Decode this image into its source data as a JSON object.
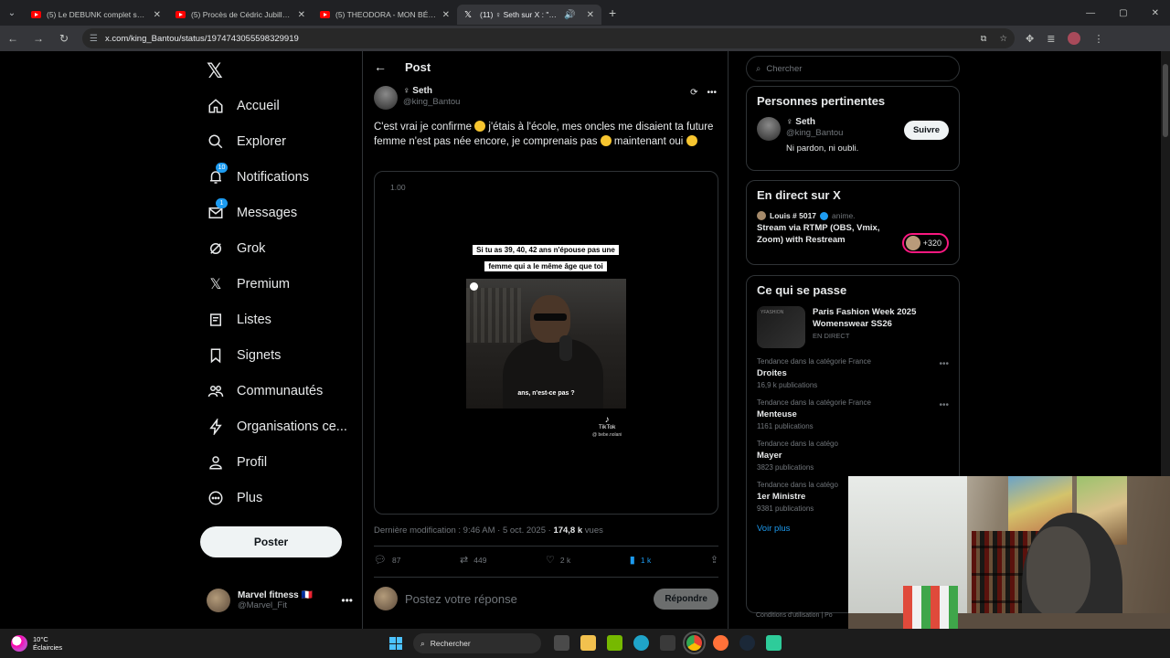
{
  "browser": {
    "tabs": [
      {
        "label": "(5) Le DEBUNK complet sur la P",
        "icon": "youtube-icon",
        "active": false
      },
      {
        "label": "(5) Procès de Cédric Jubillar - Y",
        "icon": "youtube-icon",
        "active": false
      },
      {
        "label": "(5) THEODORA - MON BÉBÉ (F",
        "icon": "youtube-icon",
        "active": false
      },
      {
        "label": "(11) ♀ Seth sur X : \"C'est vrai",
        "icon": "x-icon",
        "active": true
      }
    ],
    "url": "x.com/king_Bantou/status/1974743055598329919"
  },
  "nav": {
    "logo": "𝕏",
    "items": [
      {
        "label": "Accueil",
        "icon": "home-icon"
      },
      {
        "label": "Explorer",
        "icon": "search-icon"
      },
      {
        "label": "Notifications",
        "icon": "bell-icon",
        "badge": "10"
      },
      {
        "label": "Messages",
        "icon": "mail-icon",
        "badge": "1"
      },
      {
        "label": "Grok",
        "icon": "grok-icon"
      },
      {
        "label": "Premium",
        "icon": "x-premium-icon"
      },
      {
        "label": "Listes",
        "icon": "list-icon"
      },
      {
        "label": "Signets",
        "icon": "bookmark-icon"
      },
      {
        "label": "Communautés",
        "icon": "communities-icon"
      },
      {
        "label": "Organisations ce...",
        "icon": "lightning-icon"
      },
      {
        "label": "Profil",
        "icon": "profile-icon"
      },
      {
        "label": "Plus",
        "icon": "more-circle-icon"
      }
    ],
    "post_button": "Poster",
    "account": {
      "name": "Marvel fitness 🇫🇷",
      "handle": "@Marvel_Fit"
    }
  },
  "post": {
    "header": "Post",
    "author_name": "♀ Seth",
    "author_handle": "@king_Bantou",
    "text_1": "C'est vrai je confirme ",
    "text_2": " j'étais à l'école,  mes oncles me disaient ta future femme n'est pas née encore, je comprenais  pas ",
    "text_3": " maintenant oui ",
    "media": {
      "speed": "1.00",
      "caption": "Si tu as 39, 40, 42 ans n'épouse pas une femme qui a le même âge que toi",
      "subtitle": "ans, n'est-ce pas ?",
      "watermark": "TikTok",
      "watermark_handle": "@ bebe.nolani"
    },
    "meta_prefix": "Dernière modification : 9:46 AM · 5 oct. 2025 · ",
    "views": "174,8 k",
    "views_label": " vues",
    "stats": {
      "replies": "87",
      "reposts": "449",
      "likes": "2 k",
      "bookmarks": "1 k"
    },
    "reply_placeholder": "Postez votre réponse",
    "reply_button": "Répondre"
  },
  "sidebar": {
    "search_placeholder": "Chercher",
    "relevant": {
      "title": "Personnes pertinentes",
      "name": "♀ Seth",
      "handle": "@king_Bantou",
      "bio": "Ni pardon, ni oubli.",
      "follow": "Suivre"
    },
    "live": {
      "title": "En direct sur X",
      "user": "Louis # 5017",
      "user_suffix": "anime.",
      "stream_title": "Stream via RTMP (OBS, Vmix, Zoom) with Restream",
      "count": "+320"
    },
    "happening": {
      "title": "Ce qui se passe",
      "event_title": "Paris Fashion Week 2025 Womenswear SS26",
      "event_sub": "EN DIRECT",
      "event_thumb_text": "YFASHION",
      "trends": [
        {
          "category": "Tendance dans la catégorie France",
          "name": "Droites",
          "count": "16,9 k publications"
        },
        {
          "category": "Tendance dans la catégorie France",
          "name": "Menteuse",
          "count": "1161 publications"
        },
        {
          "category": "Tendance dans la catégo",
          "name": "Mayer",
          "count": "3823 publications"
        },
        {
          "category": "Tendance dans la catégo",
          "name": "1er Ministre",
          "count": "9381 publications"
        }
      ],
      "see_more": "Voir plus"
    },
    "footer": "Conditions d'utilisation   |   Po"
  },
  "taskbar": {
    "temperature": "10°C",
    "weather": "Éclaircies",
    "search": "Rechercher"
  },
  "colors": {
    "accent": "#1d9bf0",
    "live": "#f91880",
    "background": "#000000"
  }
}
